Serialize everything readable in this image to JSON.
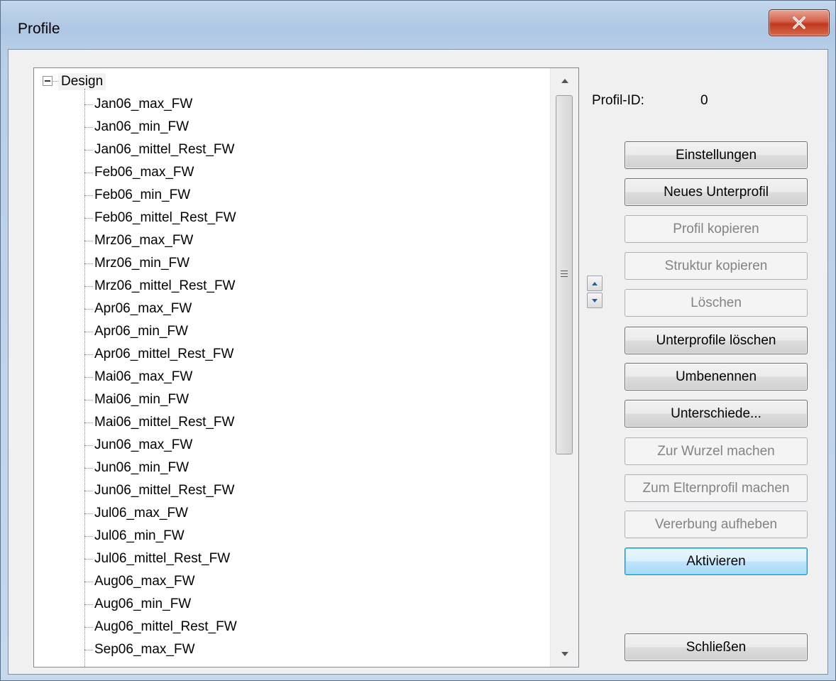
{
  "window": {
    "title": "Profile"
  },
  "tree": {
    "root": "Design",
    "children": [
      "Jan06_max_FW",
      "Jan06_min_FW",
      "Jan06_mittel_Rest_FW",
      "Feb06_max_FW",
      "Feb06_min_FW",
      "Feb06_mittel_Rest_FW",
      "Mrz06_max_FW",
      "Mrz06_min_FW",
      "Mrz06_mittel_Rest_FW",
      "Apr06_max_FW",
      "Apr06_min_FW",
      "Apr06_mittel_Rest_FW",
      "Mai06_max_FW",
      "Mai06_min_FW",
      "Mai06_mittel_Rest_FW",
      "Jun06_max_FW",
      "Jun06_min_FW",
      "Jun06_mittel_Rest_FW",
      "Jul06_max_FW",
      "Jul06_min_FW",
      "Jul06_mittel_Rest_FW",
      "Aug06_max_FW",
      "Aug06_min_FW",
      "Aug06_mittel_Rest_FW",
      "Sep06_max_FW"
    ]
  },
  "profile": {
    "id_label": "Profil-ID:",
    "id_value": "0"
  },
  "buttons": {
    "einstellungen": "Einstellungen",
    "neues_unterprofil": "Neues Unterprofil",
    "profil_kopieren": "Profil kopieren",
    "struktur_kopieren": "Struktur kopieren",
    "loeschen": "Löschen",
    "unterprofile_loeschen": "Unterprofile löschen",
    "umbenennen": "Umbenennen",
    "unterschiede": "Unterschiede...",
    "zur_wurzel": "Zur Wurzel machen",
    "zum_elternprofil": "Zum Elternprofil machen",
    "vererbung_aufheben": "Vererbung aufheben",
    "aktivieren": "Aktivieren",
    "schliessen": "Schließen"
  },
  "icons": {
    "close": "close-icon",
    "expander": "collapse-box-icon",
    "scroll_up": "chevron-up-icon",
    "scroll_down": "chevron-down-icon",
    "move_up": "arrow-up-icon",
    "move_down": "arrow-down-icon"
  }
}
